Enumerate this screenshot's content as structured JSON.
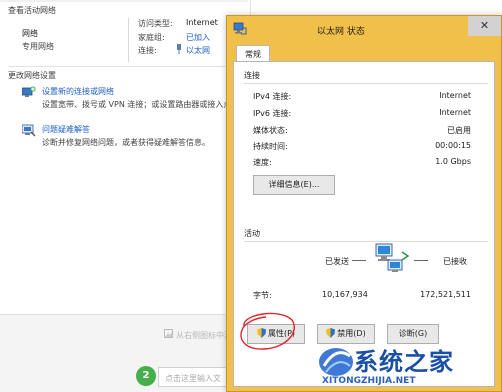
{
  "background": {
    "active_networks_header": "查看活动网络",
    "network_name": "网络",
    "network_type": "专用网络",
    "access_type_label": "访问类型:",
    "access_type_value": "Internet",
    "homegroup_label": "家庭组:",
    "homegroup_value": "已加入",
    "connections_label": "连接:",
    "connections_value": "以太网",
    "change_settings_header": "更改网络设置",
    "tasks": [
      {
        "link": "设置新的连接或网络",
        "desc": "设置宽带、拨号或 VPN 连接；或设置路由器或接入点。"
      },
      {
        "link": "问题疑难解答",
        "desc": "诊断并修复网络问题，或者获得疑难解答信息。"
      }
    ],
    "bottom_hint": "从右侧图标中添加",
    "step_number": "2",
    "input_placeholder": "点击这里输入文"
  },
  "dialog": {
    "title": "以太网 状态",
    "close_glyph": "✕",
    "tab_general": "常规",
    "connection_group": "连接",
    "rows": [
      {
        "label": "IPv4 连接:",
        "value": "Internet"
      },
      {
        "label": "IPv6 连接:",
        "value": "Internet"
      },
      {
        "label": "媒体状态:",
        "value": "已启用"
      },
      {
        "label": "持续时间:",
        "value": "00:00:15"
      },
      {
        "label": "速度:",
        "value": "1.0 Gbps"
      }
    ],
    "details_button": "详细信息(E)...",
    "activity_group": "活动",
    "sent_label": "已发送",
    "received_label": "已接收",
    "bytes_label": "字节:",
    "bytes_sent": "10,167,934",
    "bytes_received": "172,521,511",
    "properties_button": "属性(P)",
    "disable_button": "禁用(D)",
    "diagnose_button": "诊断(G)"
  },
  "watermark": {
    "text": "系统之家",
    "url": "XITONGZHIJIA.NET"
  },
  "colors": {
    "titlebar_accent": "#f0c04a",
    "link_blue": "#1c5ec8",
    "annotation_red": "#e0202a"
  }
}
